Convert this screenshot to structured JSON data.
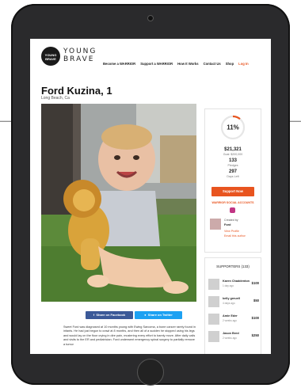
{
  "nav": {
    "logo_badge": "YOUNG BRAVE",
    "logo_line1": "YOUNG",
    "logo_line2": "BRAVE",
    "links": [
      "Become a WARRIOR",
      "Support a WARRIOR",
      "How It Works",
      "Contact Us",
      "Shop"
    ],
    "login": "Log In"
  },
  "profile": {
    "name": "Ford Kuzina, 1",
    "location": "Long Beach, Ca"
  },
  "stats": {
    "percent": "11%",
    "percent_value": 0.11,
    "raised": "$21,321",
    "goal": "Goal: $200,000",
    "pledges_count": "133",
    "pledges_label": "Pledges",
    "days_count": "297",
    "days_label": "Days Left",
    "support_button": "Support Now",
    "social_label": "WARRIOR SOCIAL ACCOUNTS",
    "social_icon": "instagram-icon"
  },
  "creator": {
    "label": "Created by",
    "name": "Ford",
    "view_profile": "View Profile",
    "email": "Email this author"
  },
  "supporters": {
    "title": "SUPPORTERS (133)",
    "items": [
      {
        "name": "Karen Chaddenton",
        "time": "1 day ago",
        "amount": "$100"
      },
      {
        "name": "kelly greuell",
        "time": "4 days ago",
        "amount": "$50"
      },
      {
        "name": "Amie Eder",
        "time": "2 weeks ago",
        "amount": "$100"
      },
      {
        "name": "Jason Bred",
        "time": "2 weeks ago",
        "amount": "$250"
      }
    ]
  },
  "share": {
    "facebook": "Share on Facebook",
    "twitter": "Share on Twitter"
  },
  "story": "Sweet Ford was diagnosed at 10 months young with Ewing Sarcoma, a bone cancer rarely found in infants. He had just begun to crawl at 8 months, and then all of a sudden he stopped using his legs and would lay on the floor crying in dire pain, mustering every effort to barely move. After daily calls and visits to the ER and pediatrician. Ford underwent emergency spinal surgery to partially remove a tumor",
  "colors": {
    "accent": "#e8541f",
    "facebook": "#3b5998",
    "twitter": "#1da1f2",
    "tablet_frame": "#2a2a2c"
  }
}
